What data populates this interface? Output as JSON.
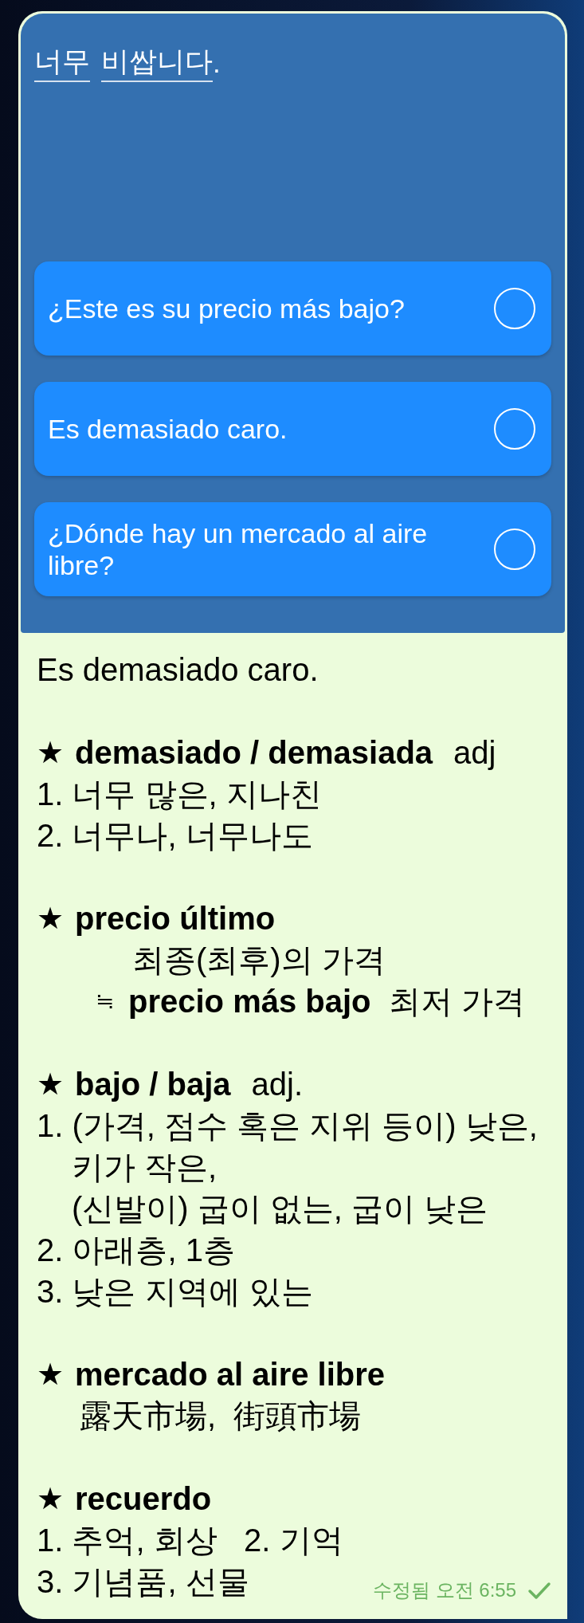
{
  "quiz": {
    "question_parts": [
      {
        "text": "너무",
        "underlined": true
      },
      {
        "text": "비쌉니다",
        "underlined": true
      }
    ],
    "question_end": ".",
    "options": [
      {
        "text": "¿Este es su precio más bajo?",
        "selected": false
      },
      {
        "text": "Es demasiado caro.",
        "selected": false
      },
      {
        "text": "¿Dónde hay un mercado al aire libre?",
        "selected": false
      }
    ]
  },
  "lines": [
    {
      "kind": "text",
      "text": "Es demasiado caro."
    },
    {
      "kind": "blank"
    },
    {
      "kind": "heading",
      "star": "★",
      "term": "demasiado / demasiada",
      "pos": "adj"
    },
    {
      "kind": "text",
      "text": "1. 너무 많은, 지나친"
    },
    {
      "kind": "text",
      "text": "2. 너무나, 너무나도"
    },
    {
      "kind": "blank"
    },
    {
      "kind": "heading",
      "star": "★",
      "term": "precio último"
    },
    {
      "kind": "gloss",
      "text": "최종(최후)의 가격"
    },
    {
      "kind": "synonym",
      "mark": "≒",
      "term": "precio más bajo",
      "text": "최저 가격"
    },
    {
      "kind": "blank"
    },
    {
      "kind": "heading",
      "star": "★",
      "term": "bajo / baja",
      "pos": "adj."
    },
    {
      "kind": "text",
      "text": "1. (가격, 점수 혹은 지위 등이) 낮은,"
    },
    {
      "kind": "continuation",
      "text": "키가 작은,"
    },
    {
      "kind": "continuation",
      "text": "(신발이) 굽이 없는, 굽이 낮은"
    },
    {
      "kind": "text",
      "text": "2. 아래층, 1층"
    },
    {
      "kind": "text",
      "text": "3. 낮은 지역에 있는"
    },
    {
      "kind": "blank"
    },
    {
      "kind": "heading",
      "star": "★",
      "term": "mercado al aire libre"
    },
    {
      "kind": "subterm",
      "text": "露天市場,  街頭市場"
    },
    {
      "kind": "blank"
    },
    {
      "kind": "heading",
      "star": "★",
      "term": "recuerdo"
    },
    {
      "kind": "text",
      "text": "1. 추억, 회상   2. 기억"
    },
    {
      "kind": "text",
      "text": "3. 기념품, 선물"
    }
  ],
  "footer": {
    "edited": "수정됨 오전 6:55",
    "read": true
  }
}
